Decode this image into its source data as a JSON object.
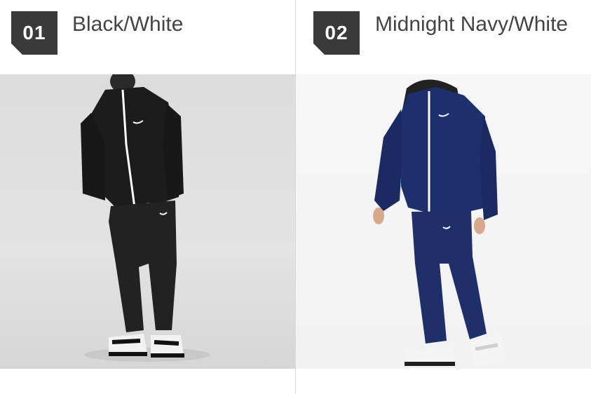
{
  "options": [
    {
      "number": "01",
      "color_name": "Black/White",
      "colors": {
        "jacket": "#1c1c1c",
        "pants": "#222222",
        "stripe": "#ffffff",
        "shoe": "#f2f2f2",
        "shoe_accent": "#111111",
        "background": "#dedede"
      }
    },
    {
      "number": "02",
      "color_name": "Midnight Navy/White",
      "colors": {
        "jacket": "#1e2f6e",
        "pants": "#1f2f6a",
        "stripe": "#ffffff",
        "shoe": "#f4f4f4",
        "shoe_accent": "#cfcfcf",
        "background": "#f4f4f4"
      }
    }
  ]
}
